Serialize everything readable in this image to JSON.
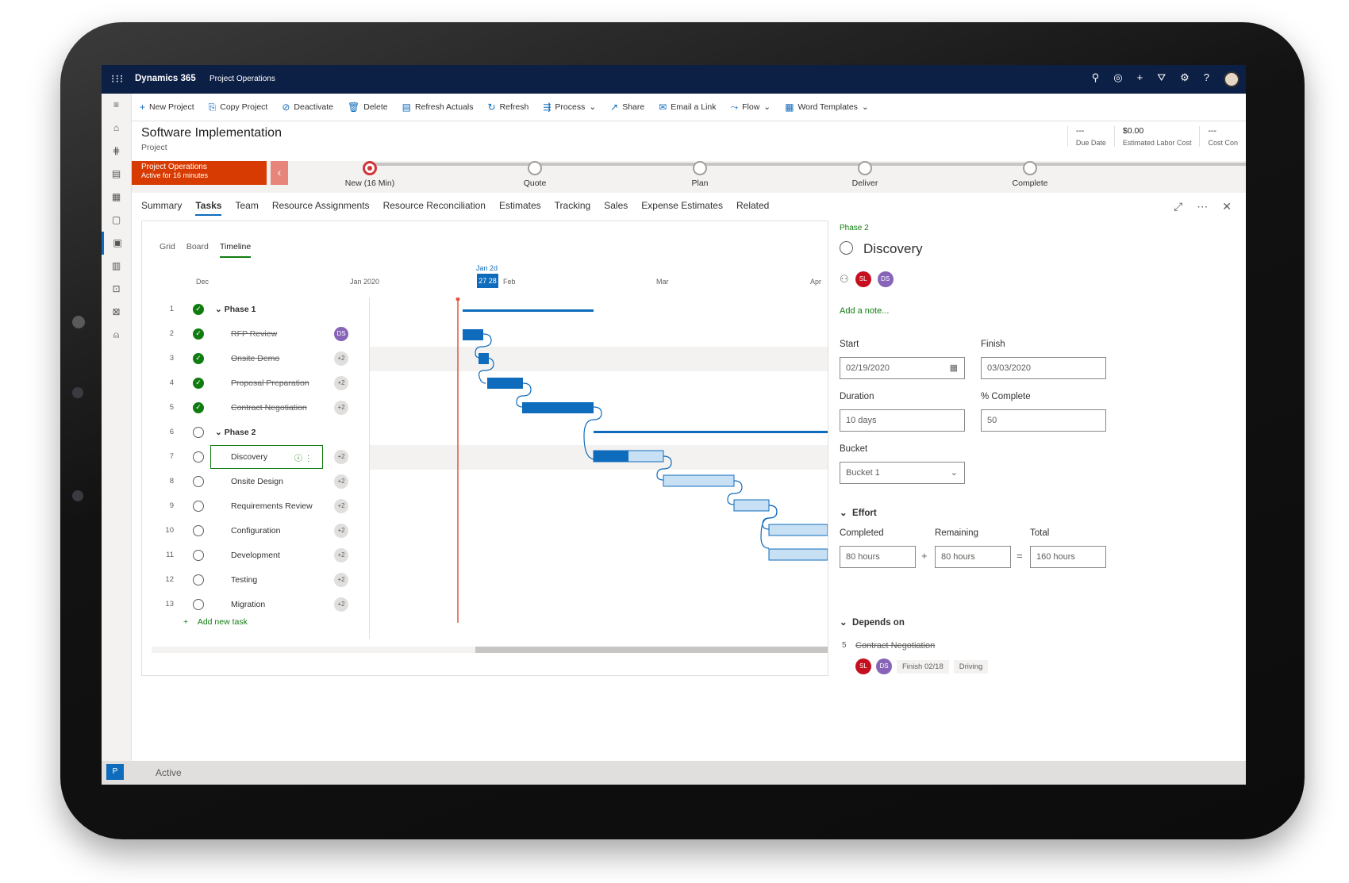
{
  "topbar": {
    "app": "Dynamics 365",
    "sub": "Project Operations"
  },
  "commands": [
    {
      "label": "New Project",
      "icon": "plus-icon"
    },
    {
      "label": "Copy Project",
      "icon": "copy-icon"
    },
    {
      "label": "Deactivate",
      "icon": "deactivate-icon"
    },
    {
      "label": "Delete",
      "icon": "delete-icon"
    },
    {
      "label": "Refresh Actuals",
      "icon": "refresh-actuals-icon"
    },
    {
      "label": "Refresh",
      "icon": "refresh-icon"
    },
    {
      "label": "Process",
      "icon": "process-icon"
    },
    {
      "label": "Share",
      "icon": "share-icon"
    },
    {
      "label": "Email a Link",
      "icon": "email-icon"
    },
    {
      "label": "Flow",
      "icon": "flow-icon"
    },
    {
      "label": "Word Templates",
      "icon": "word-icon"
    }
  ],
  "header": {
    "title": "Software Implementation",
    "subtitle": "Project",
    "fields": [
      {
        "value": "---",
        "label": "Due Date"
      },
      {
        "value": "$0.00",
        "label": "Estimated Labor Cost"
      },
      {
        "value": "---",
        "label": "Cost Con"
      }
    ]
  },
  "bpf": {
    "flag_title": "Project Operations",
    "flag_sub": "Active for 16 minutes",
    "stages": [
      "New  (16 Min)",
      "Quote",
      "Plan",
      "Deliver",
      "Complete"
    ]
  },
  "tabs": [
    "Summary",
    "Tasks",
    "Team",
    "Resource Assignments",
    "Resource Reconciliation",
    "Estimates",
    "Tracking",
    "Sales",
    "Expense Estimates",
    "Related"
  ],
  "gantt": {
    "views": [
      "Grid",
      "Board",
      "Timeline"
    ],
    "timeline": {
      "dec": "Dec",
      "jan": "Jan 2020",
      "today_label": "Jan 2d",
      "today_box": "27 28",
      "feb": "Feb",
      "mar": "Mar",
      "apr": "Apr"
    },
    "tasks": [
      {
        "n": "1",
        "name": "Phase 1",
        "done": true,
        "phase": true,
        "badge": ""
      },
      {
        "n": "2",
        "name": "RFP Review",
        "done": true,
        "phase": false,
        "badge": "DS"
      },
      {
        "n": "3",
        "name": "Onsite Demo",
        "done": true,
        "phase": false,
        "badge": "+2"
      },
      {
        "n": "4",
        "name": "Proposal Preparation",
        "done": true,
        "phase": false,
        "badge": "+2"
      },
      {
        "n": "5",
        "name": "Contract Negotiation",
        "done": true,
        "phase": false,
        "badge": "+2"
      },
      {
        "n": "6",
        "name": "Phase 2",
        "done": false,
        "phase": true,
        "badge": ""
      },
      {
        "n": "7",
        "name": "Discovery",
        "done": false,
        "phase": false,
        "badge": "+2"
      },
      {
        "n": "8",
        "name": "Onsite Design",
        "done": false,
        "phase": false,
        "badge": "+2"
      },
      {
        "n": "9",
        "name": "Requirements Review",
        "done": false,
        "phase": false,
        "badge": "+2"
      },
      {
        "n": "10",
        "name": "Configuration",
        "done": false,
        "phase": false,
        "badge": "+2"
      },
      {
        "n": "11",
        "name": "Development",
        "done": false,
        "phase": false,
        "badge": "+2"
      },
      {
        "n": "12",
        "name": "Testing",
        "done": false,
        "phase": false,
        "badge": "+2"
      },
      {
        "n": "13",
        "name": "Migration",
        "done": false,
        "phase": false,
        "badge": "+2"
      }
    ],
    "add_task": "Add new task"
  },
  "detail": {
    "phase": "Phase 2",
    "title": "Discovery",
    "assignees": [
      "SL",
      "DS"
    ],
    "add_note": "Add a note...",
    "start_label": "Start",
    "start": "02/19/2020",
    "finish_label": "Finish",
    "finish": "03/03/2020",
    "duration_label": "Duration",
    "duration": "10 days",
    "complete_label": "% Complete",
    "complete": "50",
    "bucket_label": "Bucket",
    "bucket": "Bucket 1",
    "effort_label": "Effort",
    "completed_label": "Completed",
    "completed": "80 hours",
    "remaining_label": "Remaining",
    "remaining": "80 hours",
    "total_label": "Total",
    "total": "160 hours",
    "depends_label": "Depends on",
    "dep_n": "5",
    "dep_name": "Contract Negotiation",
    "dep_finish": "Finish 02/18",
    "dep_type": "Driving",
    "plus": "+",
    "equals": "="
  },
  "status": {
    "p": "P",
    "text": "Active"
  }
}
